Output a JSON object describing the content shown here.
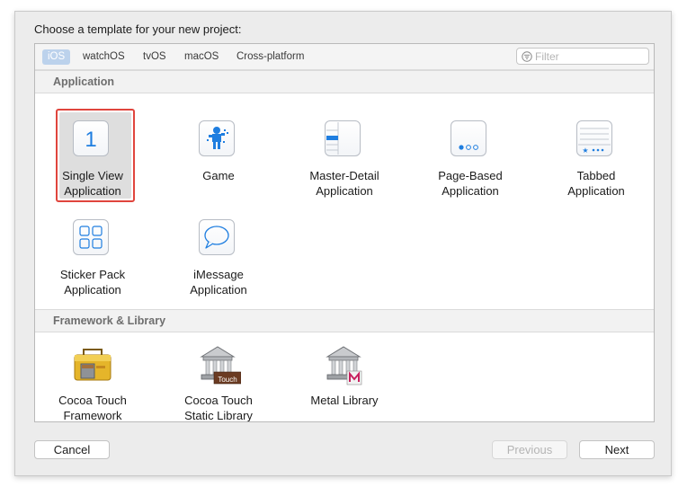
{
  "prompt": "Choose a template for your new project:",
  "tabs": [
    "iOS",
    "watchOS",
    "tvOS",
    "macOS",
    "Cross-platform"
  ],
  "selected_tab": "iOS",
  "filter": {
    "placeholder": "Filter",
    "value": ""
  },
  "sections": [
    {
      "title": "Application",
      "items": [
        {
          "line1": "Single View",
          "line2": "Application",
          "icon": "single-view-icon",
          "selected": true
        },
        {
          "line1": "Game",
          "line2": "",
          "icon": "game-icon",
          "selected": false
        },
        {
          "line1": "Master-Detail",
          "line2": "Application",
          "icon": "master-detail-icon",
          "selected": false
        },
        {
          "line1": "Page-Based",
          "line2": "Application",
          "icon": "page-based-icon",
          "selected": false
        },
        {
          "line1": "Tabbed",
          "line2": "Application",
          "icon": "tabbed-icon",
          "selected": false
        },
        {
          "line1": "Sticker Pack",
          "line2": "Application",
          "icon": "sticker-pack-icon",
          "selected": false
        },
        {
          "line1": "iMessage",
          "line2": "Application",
          "icon": "imessage-icon",
          "selected": false
        }
      ]
    },
    {
      "title": "Framework & Library",
      "items": [
        {
          "line1": "Cocoa Touch",
          "line2": "Framework",
          "icon": "toolbox-icon",
          "selected": false
        },
        {
          "line1": "Cocoa Touch",
          "line2": "Static Library",
          "icon": "static-library-icon",
          "badge": "Touch",
          "selected": false
        },
        {
          "line1": "Metal Library",
          "line2": "",
          "icon": "metal-library-icon",
          "selected": false
        }
      ]
    }
  ],
  "buttons": {
    "cancel": "Cancel",
    "previous": "Previous",
    "next": "Next"
  },
  "colors": {
    "selection_outline": "#e0453d",
    "tab_selected": "#bcd2ec",
    "icon_accent": "#1f7ee0"
  }
}
